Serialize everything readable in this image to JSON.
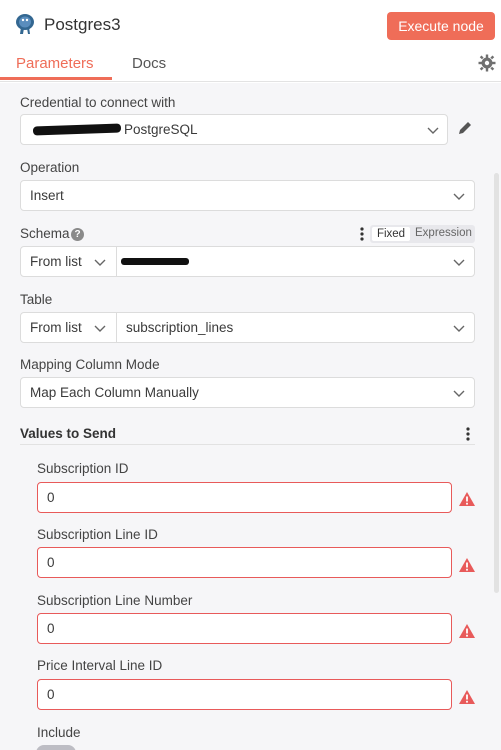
{
  "header": {
    "title": "Postgres3",
    "execute_label": "Execute node"
  },
  "tabs": {
    "parameters": "Parameters",
    "docs": "Docs"
  },
  "credential": {
    "label": "Credential to connect with",
    "value_visible": "PostgreSQL"
  },
  "operation": {
    "label": "Operation",
    "value": "Insert"
  },
  "schema": {
    "label": "Schema",
    "mode": "From list",
    "toggle_fixed": "Fixed",
    "toggle_expression": "Expression"
  },
  "table": {
    "label": "Table",
    "mode": "From list",
    "value": "subscription_lines"
  },
  "mapping": {
    "label": "Mapping Column Mode",
    "value": "Map Each Column Manually"
  },
  "values_section": {
    "title": "Values to Send",
    "fields": [
      {
        "label": "Subscription ID",
        "value": "0"
      },
      {
        "label": "Subscription Line ID",
        "value": "0"
      },
      {
        "label": "Subscription Line Number",
        "value": "0"
      },
      {
        "label": "Price Interval Line ID",
        "value": "0"
      }
    ],
    "include_label": "Include"
  },
  "colors": {
    "accent": "#ef6d58",
    "error_border": "#e85a5a",
    "warning": "#e85a5a"
  }
}
